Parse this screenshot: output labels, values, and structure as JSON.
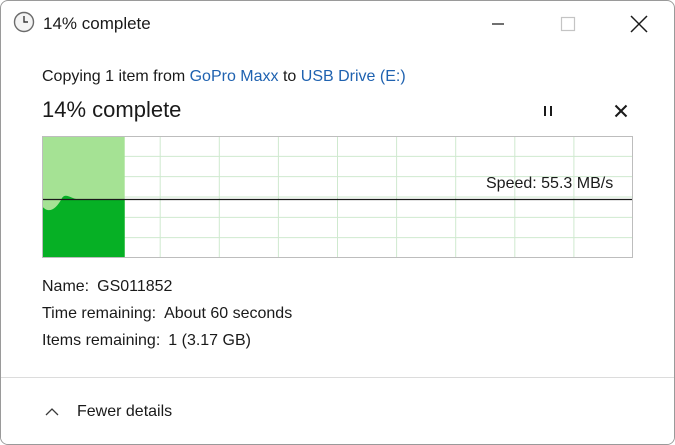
{
  "window": {
    "title": "14% complete"
  },
  "header": {
    "copying_prefix": "Copying 1 item from ",
    "source": "GoPro Maxx",
    "connector": " to ",
    "destination": "USB Drive (E:)",
    "percent_label": "14% complete"
  },
  "progress": {
    "percent": 14,
    "speed_label": "Speed: 55.3 MB/s"
  },
  "details": {
    "name_key": "Name:",
    "name_value": "GS011852",
    "time_key": "Time remaining:",
    "time_value": "About 60 seconds",
    "items_key": "Items remaining:",
    "items_value": "1 (3.17 GB)"
  },
  "footer": {
    "toggle_label": "Fewer details"
  },
  "colors": {
    "link": "#1f62b0",
    "progress_light": "#a5e294",
    "progress_dark": "#06b025",
    "grid": "#cfe9cf"
  },
  "icons": {
    "title": "clock-icon",
    "pause": "pause-icon",
    "cancel": "close-icon",
    "toggle": "chevron-up-icon"
  }
}
